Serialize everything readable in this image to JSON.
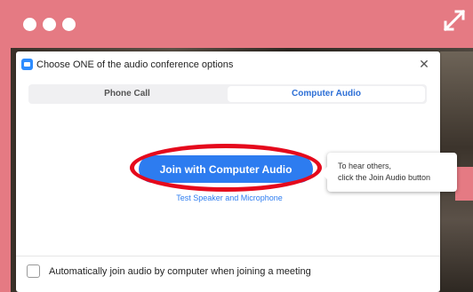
{
  "dialog": {
    "title": "Choose ONE of the audio conference options",
    "close_symbol": "✕",
    "tabs": [
      {
        "label": "Phone Call",
        "active": false
      },
      {
        "label": "Computer Audio",
        "active": true
      }
    ],
    "join_button_label": "Join with Computer Audio",
    "test_link_label": "Test Speaker and Microphone",
    "tooltip": {
      "line1": "To hear others,",
      "line2": "click the Join Audio button"
    },
    "auto_join_label": "Automatically join audio by computer when joining a meeting",
    "auto_join_checked": false
  },
  "colors": {
    "frame": "#e57a83",
    "accent": "#2d7cf0",
    "highlight_oval": "#e5091c"
  },
  "icons": [
    "window-dot-icon",
    "expand-icon",
    "zoom-logo-icon",
    "close-icon",
    "checkbox-icon"
  ]
}
